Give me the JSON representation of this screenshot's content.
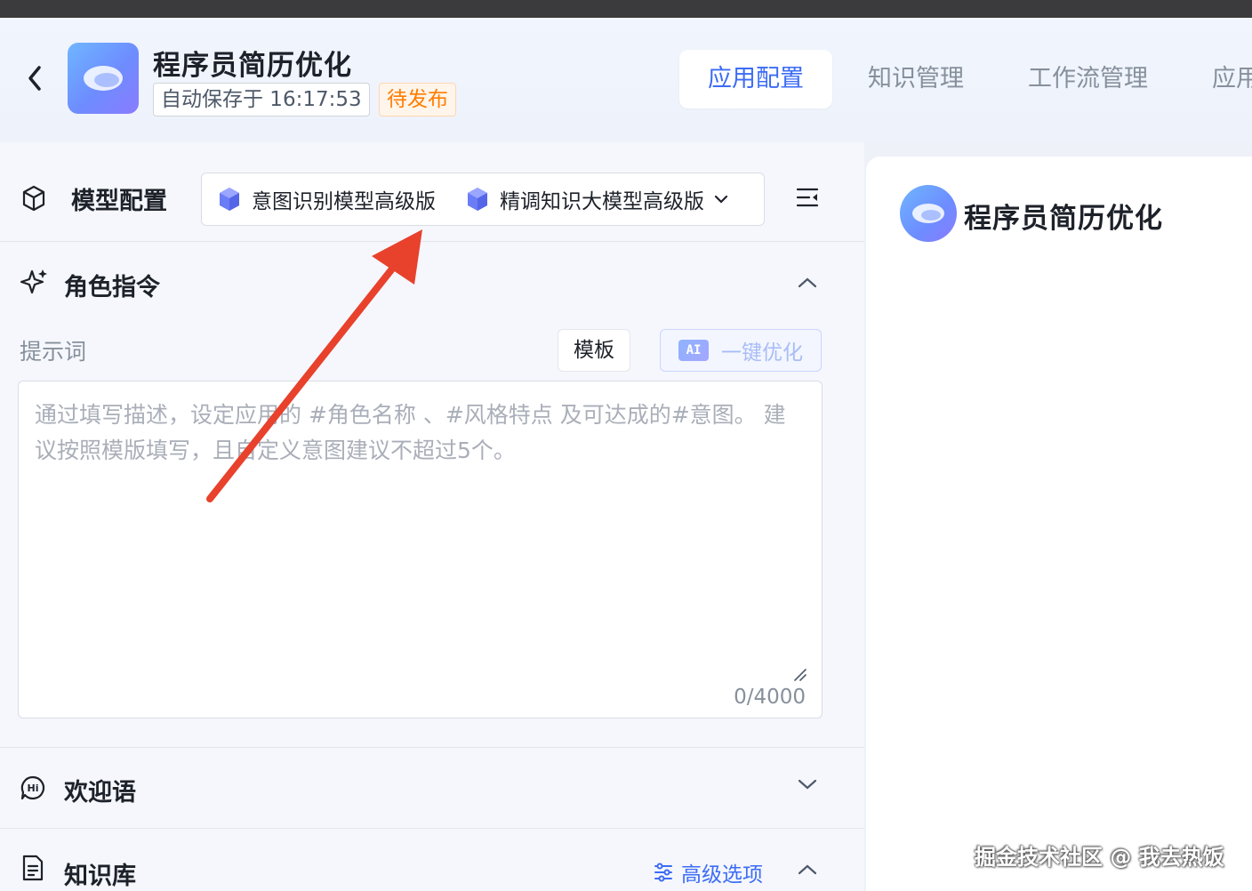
{
  "header": {
    "app_title": "程序员简历优化",
    "autosave": "自动保存于 16:17:53",
    "status": "待发布",
    "tabs": [
      {
        "label": "应用配置"
      },
      {
        "label": "知识管理"
      },
      {
        "label": "工作流管理"
      },
      {
        "label": "应用"
      }
    ]
  },
  "model_config": {
    "title": "模型配置",
    "models": [
      {
        "label": "意图识别模型高级版"
      },
      {
        "label": "精调知识大模型高级版"
      }
    ]
  },
  "role_instruction": {
    "title": "角色指令",
    "prompt_label": "提示词",
    "template_label": "模板",
    "ai_badge": "AI",
    "ai_optimize_label": "一键优化",
    "placeholder": "通过填写描述，设定应用的 #角色名称 、#风格特点 及可达成的#意图。 建议按照模版填写，且自定义意图建议不超过5个。",
    "char_count": "0/4000"
  },
  "welcome": {
    "title": "欢迎语"
  },
  "knowledge_base": {
    "title": "知识库",
    "advanced_label": "高级选项"
  },
  "preview": {
    "title": "程序员简历优化"
  },
  "attribution": "掘金技术社区 @ 我去热饭",
  "colors": {
    "accent": "#3c6cf6",
    "status_orange": "#ff7d00",
    "annotation_arrow": "#e8412c"
  }
}
